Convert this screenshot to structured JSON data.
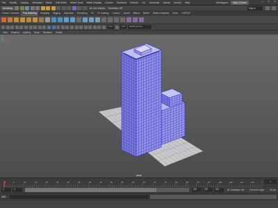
{
  "menubar": {
    "items": [
      "File",
      "Modify",
      "Display",
      "Windows",
      "Mesh",
      "Edit Mesh",
      "Mesh Tools",
      "Mesh Display",
      "Curves",
      "Surfaces",
      "Deform",
      "UV",
      "Generate",
      "Cache",
      "Arnold",
      "Help"
    ],
    "workspace_label": "Workspace:",
    "workspace_value": "Maya Classic"
  },
  "statusline": {
    "mode": "Modeling",
    "live_surface": "No Live Surface",
    "symmetry": "Symmetry: Off",
    "user": "Sign In"
  },
  "shelf_tabs": {
    "items": [
      "Curves / Surfaces",
      "Poly Modeling",
      "Sculpting",
      "Rigging",
      "Animation",
      "Rendering",
      "FX",
      "FX Caching",
      "Custom",
      "Arnold",
      "Bifrost",
      "MASH",
      "Motion Graphics",
      "XGen",
      "TURTLE"
    ],
    "active_index": 1
  },
  "viewport_toolbar": {
    "gamma": "sRGB gamma",
    "exposure": "0.00",
    "gamma_value": "1.00"
  },
  "viewport_menu": {
    "items": [
      "View",
      "Shading",
      "Lighting",
      "Show",
      "Renderer",
      "Panels"
    ]
  },
  "viewport": {
    "camera_label": "persp"
  },
  "timeslider": {
    "ticks": [
      "1",
      "5",
      "10",
      "15",
      "20",
      "25",
      "30",
      "35",
      "40",
      "45",
      "50",
      "55",
      "60",
      "65",
      "70",
      "75",
      "80",
      "85",
      "90",
      "95",
      "100",
      "105",
      "110",
      "115",
      "120"
    ],
    "current_frame": "1"
  },
  "rangeslider": {
    "start": "1",
    "inner_start": "1",
    "inner_end": "120",
    "end": "120",
    "end2": "200",
    "character_set": "No Character Set",
    "anim_layer": "No Anim Layer",
    "fps": "24 fps"
  },
  "commandline": {
    "language": "MEL"
  },
  "colors": {
    "wireframe": "#2b2bd6",
    "building_fill": "#8a8ad8",
    "grid_plane": "#c8c8cc",
    "grid_lines": "#8c8c94"
  }
}
